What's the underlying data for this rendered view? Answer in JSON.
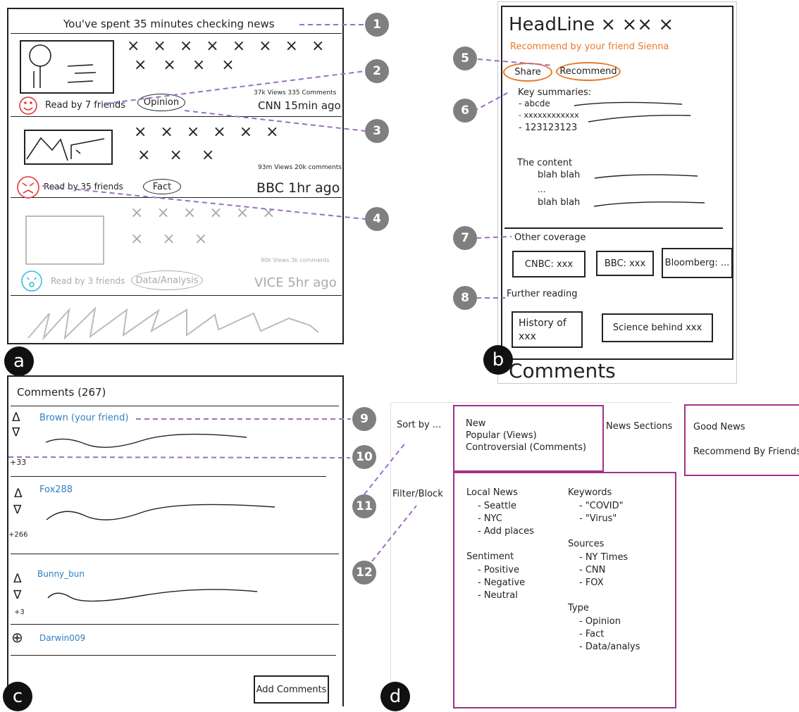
{
  "panel_a": {
    "badge": "a",
    "banner": "You've spent 35 minutes checking news",
    "articles": [
      {
        "reads": "Read by 7 friends",
        "tag": "Opinion",
        "stats": "37k Views  335 Comments",
        "source": "CNN  15min ago",
        "emoji": "smile-icon"
      },
      {
        "reads": "Read by 35 friends",
        "tag": "Fact",
        "stats": "93m Views  20k comments",
        "source": "BBC 1hr ago",
        "emoji": "angry-icon"
      },
      {
        "reads": "Read by 3 friends",
        "tag": "Data/Analysis",
        "stats": "90k Views 3k comments",
        "source": "VICE 5hr ago",
        "emoji": "crying-icon"
      }
    ]
  },
  "panel_b": {
    "badge": "b",
    "headline": "HeadLine × ×× ×",
    "recommend_note": "Recommend by your friend Sienna",
    "share": "Share",
    "recommend": "Recommend",
    "summary_title": "Key summaries:",
    "summary_items": [
      "- abcde",
      "- xxxxxxxxxxxx",
      "- 123123123"
    ],
    "content_title": "The content",
    "content_lines": [
      "blah blah",
      "...",
      "blah blah"
    ],
    "other_coverage": "Other coverage",
    "coverage": [
      "CNBC: xxx",
      "BBC: xxx",
      "Bloomberg: ..."
    ],
    "further_reading": "Further reading",
    "reading": [
      "History of xxx",
      "Science behind xxx"
    ],
    "comments_heading": "Comments"
  },
  "panel_c": {
    "badge": "c",
    "title": "Comments (267)",
    "comments": [
      {
        "user": "Brown (your friend)",
        "score": "+33"
      },
      {
        "user": "Fox288",
        "score": "+266"
      },
      {
        "user": "Bunny_bun",
        "score": "+3"
      },
      {
        "user": "Darwin009",
        "score": ""
      }
    ],
    "add_button": "Add Comments"
  },
  "panel_d": {
    "badge": "d",
    "sort_label": "Sort by ...",
    "sort_options": [
      "New",
      "Popular (Views)",
      "Controversial (Comments)"
    ],
    "sections_label": "News Sections",
    "sections": [
      "Good News",
      "Recommend By Friends"
    ],
    "filter_label": "Filter/Block",
    "local_news": {
      "title": "Local News",
      "items": [
        "- Seattle",
        "- NYC",
        "- Add places"
      ]
    },
    "sentiment": {
      "title": "Sentiment",
      "items": [
        "- Positive",
        "- Negative",
        "- Neutral"
      ]
    },
    "keywords": {
      "title": "Keywords",
      "items": [
        "- \"COVID\"",
        "- \"Virus\""
      ]
    },
    "sources": {
      "title": "Sources",
      "items": [
        "- NY Times",
        "- CNN",
        "- FOX"
      ]
    },
    "type": {
      "title": "Type",
      "items": [
        "- Opinion",
        "- Fact",
        "- Data/analys"
      ]
    }
  },
  "callouts": [
    "1",
    "2",
    "3",
    "4",
    "5",
    "6",
    "7",
    "8",
    "9",
    "10",
    "11",
    "12"
  ],
  "colors": {
    "callout": "#7f7f7f",
    "dash": "#9b6fc7",
    "orange": "#e8792b",
    "purple_border": "#a0328a",
    "link_blue": "#2f7fc1",
    "red_emoji": "#e0363b",
    "cyan_emoji": "#3bb8e6"
  }
}
